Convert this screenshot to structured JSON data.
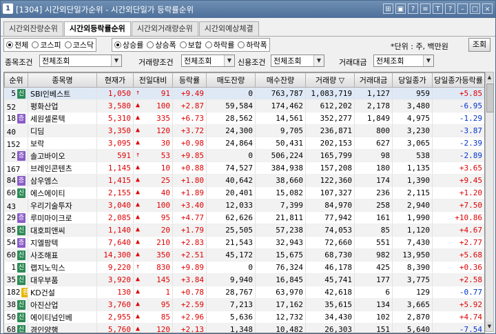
{
  "window": {
    "number": "1",
    "title": "[1304] 시간외단일가순위 - 시간외단일가 등락률순위"
  },
  "title_buttons": [
    "⊞",
    "▣",
    "?",
    "≡",
    "T",
    "?",
    "–",
    "□",
    "×"
  ],
  "tabs": [
    {
      "label": "시간외잔량순위",
      "active": false
    },
    {
      "label": "시간외등락률순위",
      "active": true
    },
    {
      "label": "시간외거래량순위",
      "active": false
    },
    {
      "label": "시간외예상체결",
      "active": false
    }
  ],
  "market_radios": [
    {
      "label": "전체",
      "checked": true
    },
    {
      "label": "코스피",
      "checked": false
    },
    {
      "label": "코스닥",
      "checked": false
    }
  ],
  "sort_radios": [
    {
      "label": "상승률",
      "checked": true
    },
    {
      "label": "상승폭",
      "checked": false
    },
    {
      "label": "보합",
      "checked": false
    },
    {
      "label": "하락률",
      "checked": false
    },
    {
      "label": "하락폭",
      "checked": false
    }
  ],
  "unit_text": "*단위 : 주, 백만원",
  "query_button": "조회",
  "filters": [
    {
      "label": "종목조건",
      "value": "전체조회"
    },
    {
      "label": "거래량조건",
      "value": "전체조회"
    },
    {
      "label": "신용조건",
      "value": "전체조회"
    },
    {
      "label": "거래대금",
      "value": "전체조회"
    }
  ],
  "columns": [
    "순위",
    "종목명",
    "현재가",
    "전일대비",
    "등락률",
    "매도잔량",
    "매수잔량",
    "거래량 ▽",
    "거래대금",
    "당일종가",
    "당일종가등락률"
  ],
  "colors": {
    "sin": "#2e8b57",
    "jeung": "#8a5cc7",
    "hwan": "#e7b800",
    "up": "#e00000",
    "down": "#0033cc"
  },
  "rows": [
    {
      "rank": "5",
      "badge": "신",
      "badge_type": "sin",
      "name": "SBI인베스트",
      "price": "1,050",
      "arrow": "↑",
      "diff": "91",
      "rate": "+9.49",
      "ask": "0",
      "bid": "763,787",
      "vol": "1,083,719",
      "amt": "1,127",
      "close": "959",
      "close_rate": "+5.85",
      "close_dir": "up"
    },
    {
      "rank": "52",
      "badge": "",
      "badge_type": "",
      "name": "평화산업",
      "price": "3,580",
      "arrow": "▲",
      "diff": "100",
      "rate": "+2.87",
      "ask": "59,584",
      "bid": "174,462",
      "vol": "612,202",
      "amt": "2,178",
      "close": "3,480",
      "close_rate": "-6.95",
      "close_dir": "down"
    },
    {
      "rank": "18",
      "badge": "증",
      "badge_type": "jeung",
      "name": "세원셀론텍",
      "price": "5,310",
      "arrow": "▲",
      "diff": "335",
      "rate": "+6.73",
      "ask": "28,562",
      "bid": "14,561",
      "vol": "352,277",
      "amt": "1,849",
      "close": "4,975",
      "close_rate": "-1.29",
      "close_dir": "down"
    },
    {
      "rank": "40",
      "badge": "",
      "badge_type": "",
      "name": "디딤",
      "price": "3,350",
      "arrow": "▲",
      "diff": "120",
      "rate": "+3.72",
      "ask": "24,300",
      "bid": "9,705",
      "vol": "236,871",
      "amt": "800",
      "close": "3,230",
      "close_rate": "-3.87",
      "close_dir": "down"
    },
    {
      "rank": "152",
      "badge": "",
      "badge_type": "",
      "name": "보락",
      "price": "3,095",
      "arrow": "▲",
      "diff": "30",
      "rate": "+0.98",
      "ask": "24,864",
      "bid": "50,431",
      "vol": "202,153",
      "amt": "627",
      "close": "3,065",
      "close_rate": "-2.39",
      "close_dir": "down"
    },
    {
      "rank": "2",
      "badge": "증",
      "badge_type": "jeung",
      "name": "솔고바이오",
      "price": "591",
      "arrow": "↑",
      "diff": "53",
      "rate": "+9.85",
      "ask": "0",
      "bid": "506,224",
      "vol": "165,799",
      "amt": "98",
      "close": "538",
      "close_rate": "-2.89",
      "close_dir": "down"
    },
    {
      "rank": "167",
      "badge": "",
      "badge_type": "",
      "name": "브레인콘텐츠",
      "price": "1,145",
      "arrow": "▲",
      "diff": "10",
      "rate": "+0.88",
      "ask": "74,527",
      "bid": "384,938",
      "vol": "157,208",
      "amt": "180",
      "close": "1,135",
      "close_rate": "+3.65",
      "close_dir": "up"
    },
    {
      "rank": "84",
      "badge": "증",
      "badge_type": "jeung",
      "name": "삼우엠스",
      "price": "1,415",
      "arrow": "▲",
      "diff": "25",
      "rate": "+1.80",
      "ask": "40,642",
      "bid": "38,660",
      "vol": "122,360",
      "amt": "174",
      "close": "1,390",
      "close_rate": "+9.45",
      "close_dir": "up"
    },
    {
      "rank": "60",
      "badge": "신",
      "badge_type": "sin",
      "name": "에스에이티",
      "price": "2,155",
      "arrow": "▲",
      "diff": "40",
      "rate": "+1.89",
      "ask": "20,401",
      "bid": "15,082",
      "vol": "107,327",
      "amt": "236",
      "close": "2,115",
      "close_rate": "+1.20",
      "close_dir": "up"
    },
    {
      "rank": "43",
      "badge": "",
      "badge_type": "",
      "name": "우리기술투자",
      "price": "3,040",
      "arrow": "▲",
      "diff": "100",
      "rate": "+3.40",
      "ask": "12,033",
      "bid": "7,399",
      "vol": "84,970",
      "amt": "258",
      "close": "2,940",
      "close_rate": "+7.50",
      "close_dir": "up"
    },
    {
      "rank": "29",
      "badge": "증",
      "badge_type": "jeung",
      "name": "루미마이크로",
      "price": "2,085",
      "arrow": "▲",
      "diff": "95",
      "rate": "+4.77",
      "ask": "62,626",
      "bid": "21,811",
      "vol": "77,942",
      "amt": "161",
      "close": "1,990",
      "close_rate": "+10.86",
      "close_dir": "up"
    },
    {
      "rank": "85",
      "badge": "신",
      "badge_type": "sin",
      "name": "대호피앤씨",
      "price": "1,140",
      "arrow": "▲",
      "diff": "20",
      "rate": "+1.79",
      "ask": "25,505",
      "bid": "57,238",
      "vol": "74,053",
      "amt": "85",
      "close": "1,120",
      "close_rate": "+4.67",
      "close_dir": "up"
    },
    {
      "rank": "54",
      "badge": "증",
      "badge_type": "jeung",
      "name": "지엘팜텍",
      "price": "7,640",
      "arrow": "▲",
      "diff": "210",
      "rate": "+2.83",
      "ask": "21,543",
      "bid": "32,943",
      "vol": "72,660",
      "amt": "551",
      "close": "7,430",
      "close_rate": "+2.77",
      "close_dir": "up"
    },
    {
      "rank": "60",
      "badge": "신",
      "badge_type": "sin",
      "name": "사조해표",
      "price": "14,300",
      "arrow": "▲",
      "diff": "350",
      "rate": "+2.51",
      "ask": "45,172",
      "bid": "15,675",
      "vol": "68,730",
      "amt": "982",
      "close": "13,950",
      "close_rate": "+5.68",
      "close_dir": "up"
    },
    {
      "rank": "1",
      "badge": "신",
      "badge_type": "sin",
      "name": "랩지노믹스",
      "price": "9,220",
      "arrow": "↑",
      "diff": "830",
      "rate": "+9.89",
      "ask": "0",
      "bid": "76,324",
      "vol": "46,178",
      "amt": "425",
      "close": "8,390",
      "close_rate": "+0.36",
      "close_dir": "up"
    },
    {
      "rank": "35",
      "badge": "신",
      "badge_type": "sin",
      "name": "대우부품",
      "price": "3,920",
      "arrow": "▲",
      "diff": "145",
      "rate": "+3.84",
      "ask": "9,940",
      "bid": "16,845",
      "vol": "45,741",
      "amt": "177",
      "close": "3,775",
      "close_rate": "+2.58",
      "close_dir": "up"
    },
    {
      "rank": "182",
      "badge": "환",
      "badge_type": "hwan",
      "name": "KD건설",
      "price": "130",
      "arrow": "▲",
      "diff": "1",
      "rate": "+0.78",
      "ask": "28,767",
      "bid": "63,970",
      "vol": "42,618",
      "amt": "6",
      "close": "129",
      "close_rate": "-0.77",
      "close_dir": "down"
    },
    {
      "rank": "38",
      "badge": "신",
      "badge_type": "sin",
      "name": "아진산업",
      "price": "3,760",
      "arrow": "▲",
      "diff": "95",
      "rate": "+2.59",
      "ask": "7,213",
      "bid": "17,162",
      "vol": "35,615",
      "amt": "134",
      "close": "3,665",
      "close_rate": "+5.92",
      "close_dir": "up"
    },
    {
      "rank": "50",
      "badge": "신",
      "badge_type": "sin",
      "name": "에이티넘인베",
      "price": "2,955",
      "arrow": "▲",
      "diff": "85",
      "rate": "+2.96",
      "ask": "5,636",
      "bid": "12,732",
      "vol": "34,430",
      "amt": "102",
      "close": "2,870",
      "close_rate": "+4.74",
      "close_dir": "up"
    },
    {
      "rank": "68",
      "badge": "신",
      "badge_type": "sin",
      "name": "경인양행",
      "price": "5,760",
      "arrow": "▲",
      "diff": "120",
      "rate": "+2.13",
      "ask": "1,348",
      "bid": "10,482",
      "vol": "26,303",
      "amt": "151",
      "close": "5,640",
      "close_rate": "-7.54",
      "close_dir": "down"
    }
  ]
}
